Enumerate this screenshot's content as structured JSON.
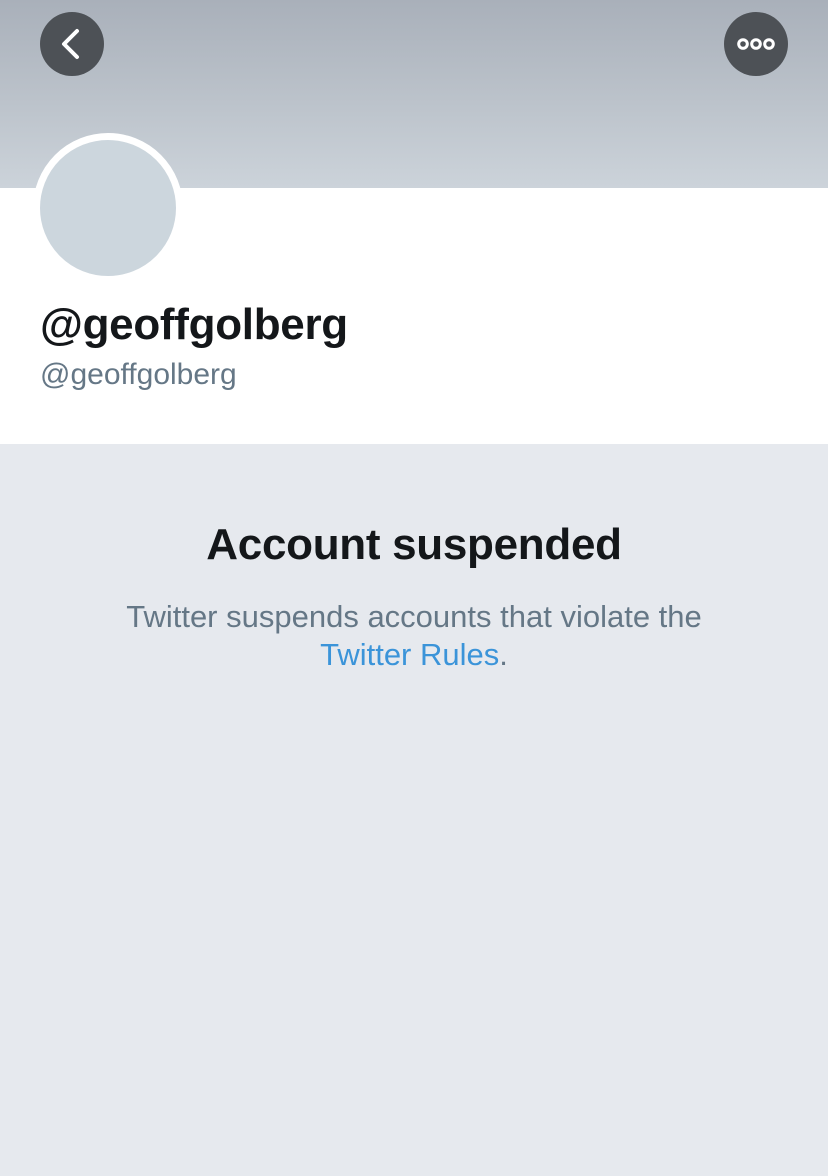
{
  "header": {
    "back_icon": "chevron-left-icon",
    "more_icon": "more-horizontal-icon",
    "banner_color_top": "#a9b0ba",
    "banner_color_bottom": "#ccd3da",
    "button_color": "#4d5156"
  },
  "profile": {
    "display_name": "@geoffgolberg",
    "handle": "@geoffgolberg",
    "avatar_color": "#ccd6dd"
  },
  "suspension": {
    "title": "Account suspended",
    "message": "Twitter suspends accounts that violate the",
    "link_text": "Twitter Rules",
    "trailing": ".",
    "link_color": "#3b94d9"
  }
}
